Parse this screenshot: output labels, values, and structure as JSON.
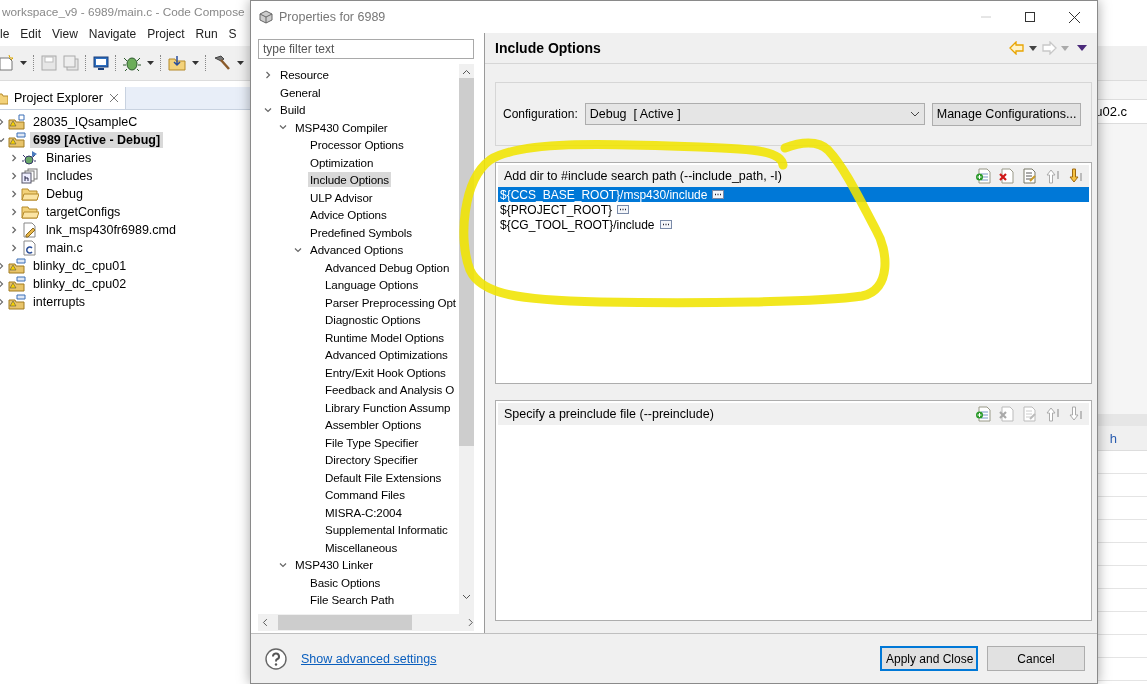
{
  "ide": {
    "title": "workspace_v9 - 6989/main.c - Code Compose",
    "menu": [
      "le",
      "Edit",
      "View",
      "Navigate",
      "Project",
      "Run",
      "S"
    ],
    "explorer_tab": "Project Explorer",
    "projects": [
      {
        "label": "28035_IQsampleC",
        "kind": "c-project",
        "expanded": false,
        "selected": false,
        "active": false
      },
      {
        "label": "6989  [Active - Debug]",
        "kind": "ccs-project",
        "expanded": true,
        "selected": true,
        "active": true,
        "children": [
          {
            "label": "Binaries",
            "kind": "binaries",
            "expanded": false,
            "selected": false
          },
          {
            "label": "Includes",
            "kind": "includes",
            "expanded": false,
            "selected": false
          },
          {
            "label": "Debug",
            "kind": "folder",
            "expanded": false,
            "selected": false
          },
          {
            "label": "targetConfigs",
            "kind": "folder",
            "expanded": false,
            "selected": false
          },
          {
            "label": "lnk_msp430fr6989.cmd",
            "kind": "linker-file",
            "expanded": false,
            "selected": false
          },
          {
            "label": "main.c",
            "kind": "c-file",
            "expanded": false,
            "selected": false
          }
        ]
      },
      {
        "label": "blinky_dc_cpu01",
        "kind": "ccs-project",
        "expanded": false,
        "selected": false,
        "active": false
      },
      {
        "label": "blinky_dc_cpu02",
        "kind": "ccs-project",
        "expanded": false,
        "selected": false,
        "active": false
      },
      {
        "label": "interrupts",
        "kind": "ccs-project",
        "expanded": false,
        "selected": false,
        "active": false
      }
    ],
    "editor_tab": "u02.c",
    "panel_text": "h"
  },
  "dialog": {
    "title": "Properties for 6989",
    "filter": {
      "placeholder": "type filter text"
    },
    "tree": [
      {
        "label": "Resource",
        "expanded": false,
        "selected": false
      },
      {
        "label": "General",
        "selected": false
      },
      {
        "label": "Build",
        "expanded": true,
        "selected": false,
        "children": [
          {
            "label": "MSP430 Compiler",
            "expanded": true,
            "selected": false,
            "children": [
              {
                "label": "Processor Options",
                "selected": false
              },
              {
                "label": "Optimization",
                "selected": false
              },
              {
                "label": "Include Options",
                "selected": true
              },
              {
                "label": "ULP Advisor",
                "selected": false
              },
              {
                "label": "Advice Options",
                "selected": false
              },
              {
                "label": "Predefined Symbols",
                "selected": false
              },
              {
                "label": "Advanced Options",
                "expanded": true,
                "selected": false,
                "children": [
                  {
                    "label": "Advanced Debug Option",
                    "selected": false
                  },
                  {
                    "label": "Language Options",
                    "selected": false
                  },
                  {
                    "label": "Parser Preprocessing Opt",
                    "selected": false
                  },
                  {
                    "label": "Diagnostic Options",
                    "selected": false
                  },
                  {
                    "label": "Runtime Model Options",
                    "selected": false
                  },
                  {
                    "label": "Advanced Optimizations",
                    "selected": false
                  },
                  {
                    "label": "Entry/Exit Hook Options",
                    "selected": false
                  },
                  {
                    "label": "Feedback and Analysis O",
                    "selected": false
                  },
                  {
                    "label": "Library Function Assump",
                    "selected": false
                  },
                  {
                    "label": "Assembler Options",
                    "selected": false
                  },
                  {
                    "label": "File Type Specifier",
                    "selected": false
                  },
                  {
                    "label": "Directory Specifier",
                    "selected": false
                  },
                  {
                    "label": "Default File Extensions",
                    "selected": false
                  },
                  {
                    "label": "Command Files",
                    "selected": false
                  },
                  {
                    "label": "MISRA-C:2004",
                    "selected": false
                  },
                  {
                    "label": "Supplemental Informatic",
                    "selected": false
                  },
                  {
                    "label": "Miscellaneous",
                    "selected": false
                  }
                ]
              }
            ]
          },
          {
            "label": "MSP430 Linker",
            "expanded": true,
            "selected": false,
            "children": [
              {
                "label": "Basic Options",
                "selected": false
              },
              {
                "label": "File Search Path",
                "selected": false
              }
            ]
          }
        ]
      }
    ],
    "page_title": "Include Options",
    "nav": [
      {
        "kind": "back",
        "disabled": false
      },
      {
        "kind": "forward",
        "disabled": true
      }
    ],
    "configuration": {
      "label": "Configuration:",
      "value": "Debug  [ Active ]",
      "button": "Manage Configurations..."
    },
    "lists": [
      {
        "title": "Add dir to #include search path (--include_path, -I)",
        "tools": [
          {
            "kind": "add",
            "disabled": false
          },
          {
            "kind": "delete",
            "disabled": false
          },
          {
            "kind": "edit",
            "disabled": false
          },
          {
            "kind": "up",
            "disabled": true
          },
          {
            "kind": "down",
            "disabled": false
          }
        ],
        "items": [
          {
            "text": "${CCS_BASE_ROOT}/msp430/include",
            "selected": true
          },
          {
            "text": "${PROJECT_ROOT}",
            "selected": false
          },
          {
            "text": "${CG_TOOL_ROOT}/include",
            "selected": false
          }
        ]
      },
      {
        "title": "Specify a preinclude file (--preinclude)",
        "tools": [
          {
            "kind": "add",
            "disabled": false
          },
          {
            "kind": "delete",
            "disabled": true
          },
          {
            "kind": "edit",
            "disabled": true
          },
          {
            "kind": "up",
            "disabled": true
          },
          {
            "kind": "down",
            "disabled": true
          }
        ]
      }
    ],
    "advanced_link": "Show advanced settings",
    "buttons": [
      {
        "label": "Apply and Close",
        "default": true
      },
      {
        "label": "Cancel",
        "default": false
      }
    ]
  }
}
